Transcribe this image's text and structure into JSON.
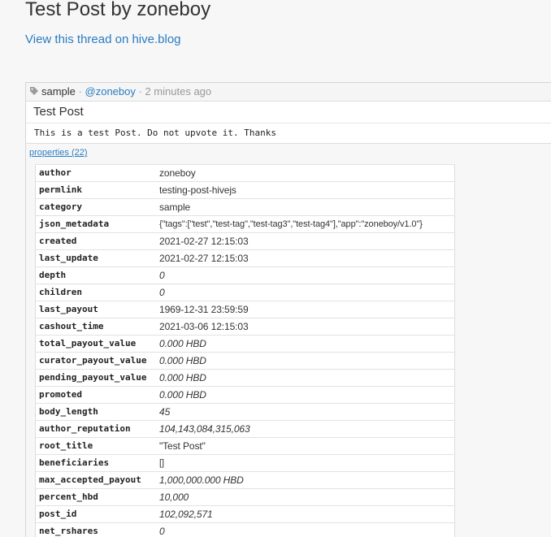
{
  "page": {
    "title": "Test Post by zoneboy",
    "thread_link": "View this thread on hive.blog"
  },
  "post": {
    "tag": "sample",
    "author": "@zoneboy",
    "separator": "·",
    "time_ago": "2 minutes ago",
    "title": "Test Post",
    "body": "This is a test Post. Do not upvote it. Thanks",
    "properties_label": "properties (22)",
    "icons": {
      "tag": "tag-icon"
    }
  },
  "properties": [
    {
      "key": "author",
      "value": "zoneboy",
      "style": "green"
    },
    {
      "key": "permlink",
      "value": "testing-post-hivejs",
      "style": "green"
    },
    {
      "key": "category",
      "value": "sample",
      "style": "green"
    },
    {
      "key": "json_metadata",
      "value": "{\"tags\":[\"test\",\"test-tag\",\"test-tag3\",\"test-tag4\"],\"app\":\"zoneboy/v1.0\"}",
      "style": "json"
    },
    {
      "key": "created",
      "value": "2021-02-27 12:15:03",
      "style": "plain"
    },
    {
      "key": "last_update",
      "value": "2021-02-27 12:15:03",
      "style": "plain"
    },
    {
      "key": "depth",
      "value": "0",
      "style": "ital"
    },
    {
      "key": "children",
      "value": "0",
      "style": "ital"
    },
    {
      "key": "last_payout",
      "value": "1969-12-31 23:59:59",
      "style": "plain"
    },
    {
      "key": "cashout_time",
      "value": "2021-03-06 12:15:03",
      "style": "plain"
    },
    {
      "key": "total_payout_value",
      "value": "0.000 HBD",
      "style": "ital"
    },
    {
      "key": "curator_payout_value",
      "value": "0.000 HBD",
      "style": "ital"
    },
    {
      "key": "pending_payout_value",
      "value": "0.000 HBD",
      "style": "ital"
    },
    {
      "key": "promoted",
      "value": "0.000 HBD",
      "style": "ital"
    },
    {
      "key": "body_length",
      "value": "45",
      "style": "ital"
    },
    {
      "key": "author_reputation",
      "value": "104,143,084,315,063",
      "style": "ital"
    },
    {
      "key": "root_title",
      "value": "\"Test Post\"",
      "style": "plain"
    },
    {
      "key": "beneficiaries",
      "value": "[]",
      "style": "mono"
    },
    {
      "key": "max_accepted_payout",
      "value": "1,000,000.000 HBD",
      "style": "ital"
    },
    {
      "key": "percent_hbd",
      "value": "10,000",
      "style": "ital"
    },
    {
      "key": "post_id",
      "value": "102,092,571",
      "style": "ital"
    },
    {
      "key": "net_rshares",
      "value": "0",
      "style": "ital"
    }
  ],
  "colors": {
    "link": "#2a7cc2",
    "green_value": "#1a8a1a",
    "background": "#f7f7f7"
  }
}
